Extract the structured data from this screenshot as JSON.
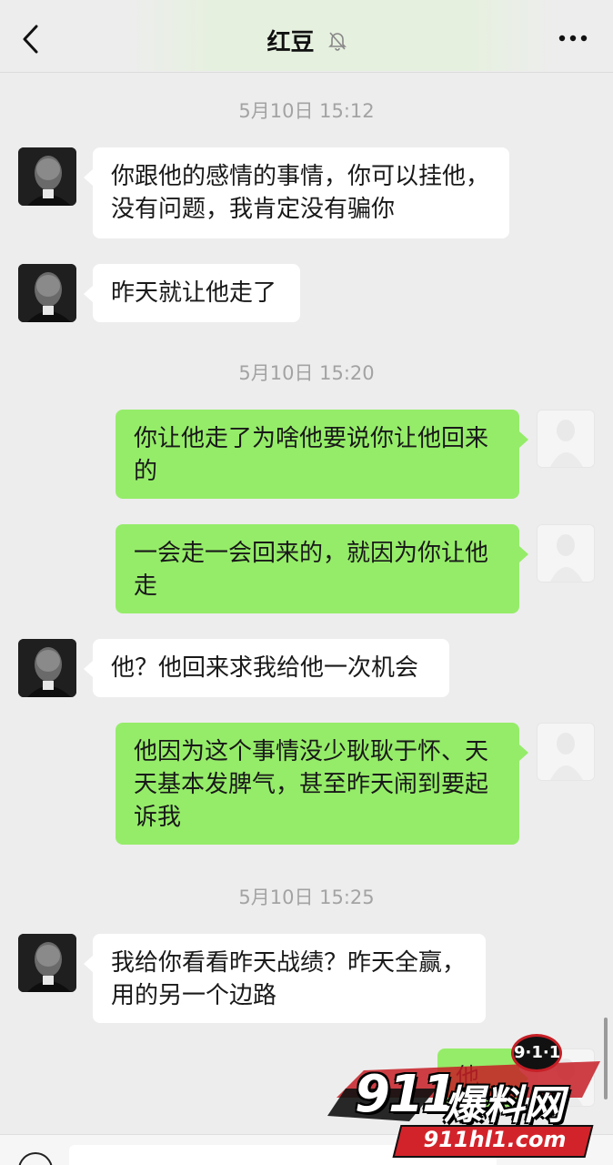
{
  "header": {
    "title": "红豆",
    "back_icon": "chevron-left-icon",
    "mute_icon": "bell-muted-icon",
    "more_icon": "more-dots-icon"
  },
  "timestamps": [
    "5月10日 15:12",
    "5月10日 15:20",
    "5月10日 15:25"
  ],
  "messages": [
    {
      "side": "left",
      "text": "你跟他的感情的事情，你可以挂他，没有问题，我肯定没有骗你"
    },
    {
      "side": "left",
      "text": "昨天就让他走了"
    },
    {
      "side": "right",
      "text": "你让他走了为啥他要说你让他回来的"
    },
    {
      "side": "right",
      "text": "一会走一会回来的，就因为你让他走"
    },
    {
      "side": "left",
      "text": "他？他回来求我给他一次机会"
    },
    {
      "side": "right",
      "text": "他因为这个事情没少耿耿于怀、天天基本发脾气，甚至昨天闹到要起诉我"
    },
    {
      "side": "left",
      "text": "我给你看看昨天战绩？昨天全赢，用的另一个边路"
    },
    {
      "side": "right",
      "text": "他说"
    }
  ],
  "watermark": {
    "badge": "9·1·1",
    "number": "911",
    "name": "爆料网",
    "url": "911hl1.com"
  },
  "colors": {
    "background": "#ededed",
    "self_bubble": "#95ec69",
    "other_bubble": "#ffffff",
    "timestamp": "#a3a3a3"
  }
}
